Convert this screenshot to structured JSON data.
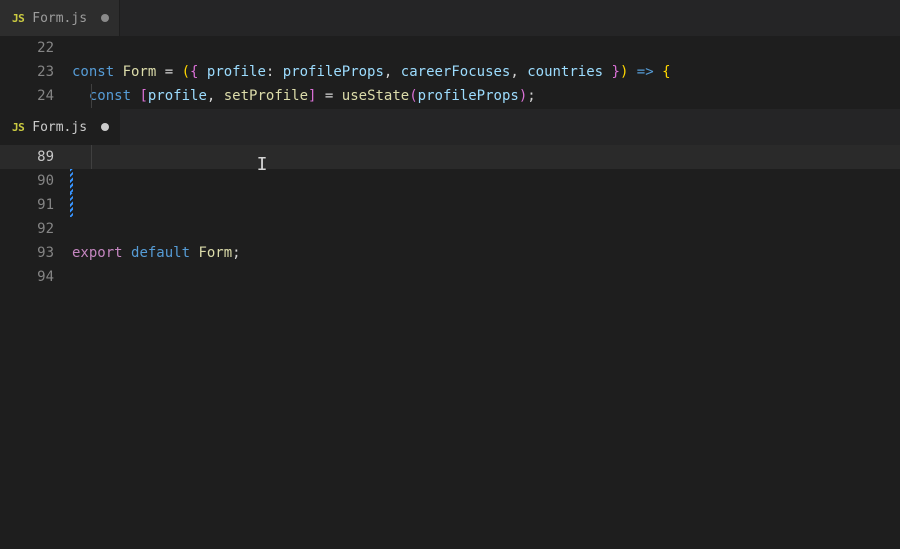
{
  "topPane": {
    "tab": {
      "icon": "JS",
      "filename": "Form.js",
      "dirty": true,
      "active": false
    },
    "lines": [
      {
        "num": "22",
        "tokens": []
      },
      {
        "num": "23",
        "tokens": [
          {
            "t": "const ",
            "c": "tk-const"
          },
          {
            "t": "Form",
            "c": "tk-fn"
          },
          {
            "t": " = ",
            "c": "tk-punc"
          },
          {
            "t": "(",
            "c": "tk-brace-y"
          },
          {
            "t": "{ ",
            "c": "tk-brace-p"
          },
          {
            "t": "profile",
            "c": "tk-var"
          },
          {
            "t": ": ",
            "c": "tk-punc"
          },
          {
            "t": "profileProps",
            "c": "tk-var"
          },
          {
            "t": ", ",
            "c": "tk-punc"
          },
          {
            "t": "careerFocuses",
            "c": "tk-var"
          },
          {
            "t": ", ",
            "c": "tk-punc"
          },
          {
            "t": "countries",
            "c": "tk-var"
          },
          {
            "t": " }",
            "c": "tk-brace-p"
          },
          {
            "t": ")",
            "c": "tk-brace-y"
          },
          {
            "t": " => ",
            "c": "tk-const"
          },
          {
            "t": "{",
            "c": "tk-brace-y"
          }
        ]
      },
      {
        "num": "24",
        "tokens": [
          {
            "t": "  ",
            "c": ""
          },
          {
            "t": "const ",
            "c": "tk-const"
          },
          {
            "t": "[",
            "c": "tk-brace-p"
          },
          {
            "t": "profile",
            "c": "tk-var"
          },
          {
            "t": ", ",
            "c": "tk-punc"
          },
          {
            "t": "setProfile",
            "c": "tk-fn"
          },
          {
            "t": "]",
            "c": "tk-brace-p"
          },
          {
            "t": " = ",
            "c": "tk-punc"
          },
          {
            "t": "useState",
            "c": "tk-fn"
          },
          {
            "t": "(",
            "c": "tk-brace-p"
          },
          {
            "t": "profileProps",
            "c": "tk-var"
          },
          {
            "t": ")",
            "c": "tk-brace-p"
          },
          {
            "t": ";",
            "c": "tk-punc"
          }
        ]
      }
    ]
  },
  "bottomPane": {
    "tab": {
      "icon": "JS",
      "filename": "Form.js",
      "dirty": true,
      "active": true
    },
    "lines": [
      {
        "num": "89",
        "current": true,
        "tokens": []
      },
      {
        "num": "90",
        "stripe": true,
        "tokens": []
      },
      {
        "num": "91",
        "stripe": true,
        "tokens": []
      },
      {
        "num": "92",
        "tokens": []
      },
      {
        "num": "93",
        "tokens": [
          {
            "t": "export ",
            "c": "tk-default"
          },
          {
            "t": "default ",
            "c": "tk-const"
          },
          {
            "t": "Form",
            "c": "tk-fn"
          },
          {
            "t": ";",
            "c": "tk-punc"
          }
        ]
      },
      {
        "num": "94",
        "tokens": []
      }
    ],
    "cursor": {
      "glyph": "I"
    }
  }
}
